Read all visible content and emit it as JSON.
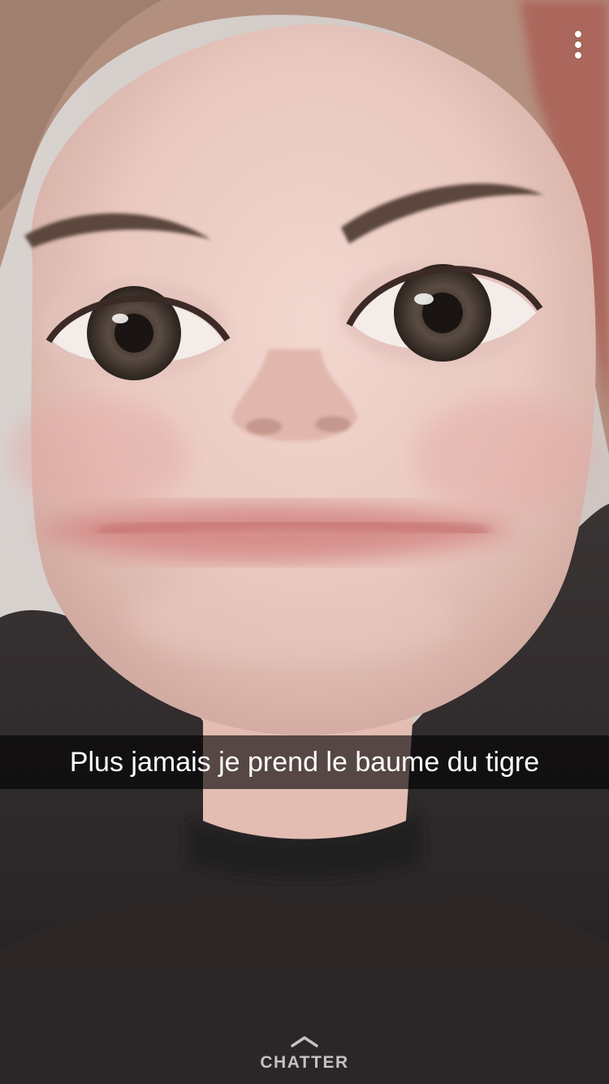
{
  "snap": {
    "caption": "Plus jamais je prend le baume du tigre",
    "chat_label": "CHATTER"
  },
  "icons": {
    "more": "more-vertical-icon",
    "chat_arrow": "chevron-up-icon"
  },
  "colors": {
    "caption_bar": "rgba(0,0,0,0.62)",
    "text": "#ffffff"
  }
}
